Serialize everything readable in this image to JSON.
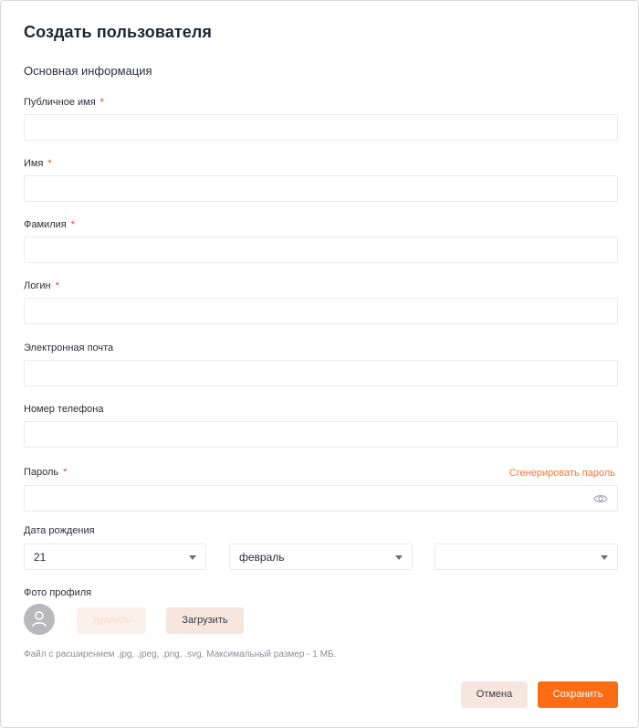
{
  "dialog": {
    "title": "Создать пользователя",
    "section_title": "Основная информация"
  },
  "fields": {
    "public_name": {
      "label": "Публичное имя",
      "required_mark": "*",
      "value": ""
    },
    "first_name": {
      "label": "Имя",
      "required_mark": "*",
      "value": ""
    },
    "last_name": {
      "label": "Фамилия",
      "required_mark": "*",
      "value": ""
    },
    "login": {
      "label": "Логин",
      "required_mark": "*",
      "value": ""
    },
    "email": {
      "label": "Электронная почта",
      "value": ""
    },
    "phone": {
      "label": "Номер телефона",
      "value": ""
    },
    "password": {
      "label": "Пароль",
      "required_mark": "*",
      "value": "",
      "generate_link": "Сгенерировать пароль",
      "visibility_icon": "eye-icon"
    }
  },
  "birth_date": {
    "label": "Дата рождения",
    "day": "21",
    "month": "февраль",
    "year": ""
  },
  "photo": {
    "label": "Фото профиля",
    "avatar_icon": "user-icon",
    "delete_label": "Удалить",
    "upload_label": "Загрузить",
    "hint": "Файл с расширением .jpg, .jpeg, .png, .svg. Максимальный размер - 1 МБ."
  },
  "footer": {
    "cancel_label": "Отмена",
    "save_label": "Сохранить"
  },
  "colors": {
    "accent": "#fb6c13",
    "required": "#e2482b",
    "link": "#f07834"
  }
}
